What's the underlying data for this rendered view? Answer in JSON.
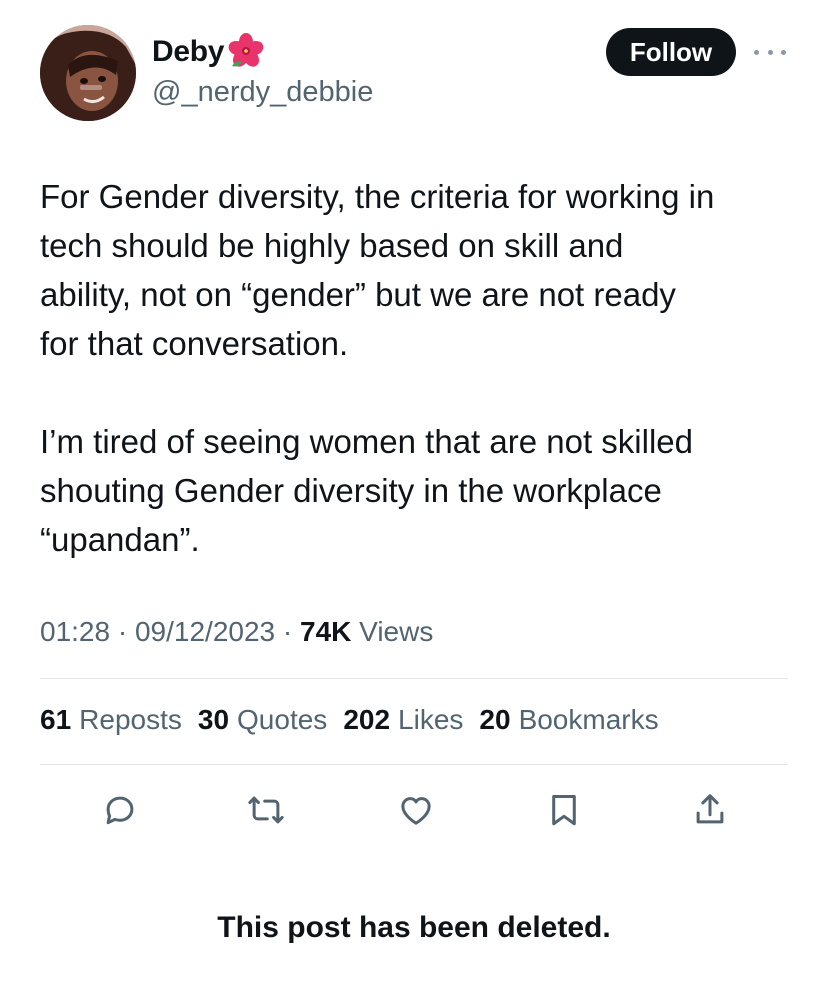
{
  "author": {
    "display_name": "Deby",
    "handle": "@_nerdy_debbie",
    "name_emoji_icon": "hibiscus-icon"
  },
  "follow_label": "Follow",
  "post": {
    "paragraph_1": "For Gender diversity, the criteria for working in\ntech should be highly based on skill and\nability, not on “gender” but we are not ready\nfor that conversation.",
    "paragraph_2": "I’m tired of seeing women that are not skilled\nshouting Gender diversity in the workplace\n“upandan”."
  },
  "meta": {
    "time": "01:28",
    "date": "09/12/2023",
    "views_count": "74K",
    "views_label": "Views"
  },
  "stats": {
    "reposts_count": "61",
    "reposts_label": "Reposts",
    "quotes_count": "30",
    "quotes_label": "Quotes",
    "likes_count": "202",
    "likes_label": "Likes",
    "bookmarks_count": "20",
    "bookmarks_label": "Bookmarks"
  },
  "actions": [
    "reply-icon",
    "repost-icon",
    "like-icon",
    "bookmark-icon",
    "share-icon"
  ],
  "deleted_notice": "This post has been deleted.",
  "colors": {
    "text_primary": "#0f1419",
    "text_secondary": "#536471",
    "divider": "#e1e6ea",
    "follow_button": "#0f1419"
  }
}
